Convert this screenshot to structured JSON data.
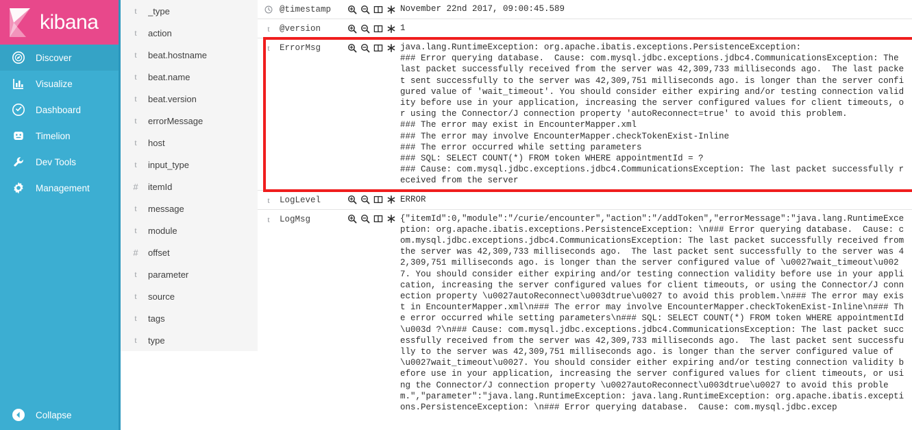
{
  "brand": {
    "name": "kibana",
    "logo_icon": "kibana-logo-icon",
    "bar_color": "#e8488b",
    "nav_color": "#3caed2",
    "nav_active_color": "#35a3c6"
  },
  "globalnav": {
    "items": [
      {
        "label": "Discover",
        "icon": "discover-compass-icon",
        "active": true
      },
      {
        "label": "Visualize",
        "icon": "visualize-bars-icon",
        "active": false
      },
      {
        "label": "Dashboard",
        "icon": "dashboard-gauge-icon",
        "active": false
      },
      {
        "label": "Timelion",
        "icon": "timelion-icon",
        "active": false
      },
      {
        "label": "Dev Tools",
        "icon": "wrench-icon",
        "active": false
      },
      {
        "label": "Management",
        "icon": "gear-icon",
        "active": false
      }
    ],
    "collapse": {
      "label": "Collapse",
      "icon": "collapse-left-arrow-icon"
    }
  },
  "fieldbar": {
    "fields": [
      {
        "name": "_type",
        "type": "t"
      },
      {
        "name": "action",
        "type": "t"
      },
      {
        "name": "beat.hostname",
        "type": "t"
      },
      {
        "name": "beat.name",
        "type": "t"
      },
      {
        "name": "beat.version",
        "type": "t"
      },
      {
        "name": "errorMessage",
        "type": "t"
      },
      {
        "name": "host",
        "type": "t"
      },
      {
        "name": "input_type",
        "type": "t"
      },
      {
        "name": "itemId",
        "type": "#"
      },
      {
        "name": "message",
        "type": "t"
      },
      {
        "name": "module",
        "type": "t"
      },
      {
        "name": "offset",
        "type": "#"
      },
      {
        "name": "parameter",
        "type": "t"
      },
      {
        "name": "source",
        "type": "t"
      },
      {
        "name": "tags",
        "type": "t"
      },
      {
        "name": "type",
        "type": "t"
      }
    ]
  },
  "doc_actions": {
    "filter_for_value": "magnifier-plus-icon",
    "filter_out_value": "magnifier-minus-icon",
    "toggle_column": "toggle-column-icon",
    "filter_for_field_present": "asterisk-icon"
  },
  "document": {
    "rows": [
      {
        "field": "@timestamp",
        "type": "clock",
        "value": "November 22nd 2017, 09:00:45.589",
        "highlighted": false
      },
      {
        "field": "@version",
        "type": "t",
        "value": "1",
        "highlighted": false
      },
      {
        "field": "ErrorMsg",
        "type": "t",
        "highlighted": true,
        "value": "java.lang.RuntimeException: org.apache.ibatis.exceptions.PersistenceException:\n### Error querying database.  Cause: com.mysql.jdbc.exceptions.jdbc4.CommunicationsException: The last packet successfully received from the server was 42,309,733 milliseconds ago.  The last packet sent successfully to the server was 42,309,751 milliseconds ago. is longer than the server configured value of 'wait_timeout'. You should consider either expiring and/or testing connection validity before use in your application, increasing the server configured values for client timeouts, or using the Connector/J connection property 'autoReconnect=true' to avoid this problem.\n### The error may exist in EncounterMapper.xml\n### The error may involve EncounterMapper.checkTokenExist-Inline\n### The error occurred while setting parameters\n### SQL: SELECT COUNT(*) FROM token WHERE appointmentId = ?\n### Cause: com.mysql.jdbc.exceptions.jdbc4.CommunicationsException: The last packet successfully received from the server"
      },
      {
        "field": "LogLevel",
        "type": "t",
        "value": "ERROR",
        "highlighted": false
      },
      {
        "field": "LogMsg",
        "type": "t",
        "highlighted": false,
        "value": "{\"itemId\":0,\"module\":\"/curie/encounter\",\"action\":\"/addToken\",\"errorMessage\":\"java.lang.RuntimeException: org.apache.ibatis.exceptions.PersistenceException: \\n### Error querying database.  Cause: com.mysql.jdbc.exceptions.jdbc4.CommunicationsException: The last packet successfully received from the server was 42,309,733 milliseconds ago.  The last packet sent successfully to the server was 42,309,751 milliseconds ago. is longer than the server configured value of \\u0027wait_timeout\\u0027. You should consider either expiring and/or testing connection validity before use in your application, increasing the server configured values for client timeouts, or using the Connector/J connection property \\u0027autoReconnect\\u003dtrue\\u0027 to avoid this problem.\\n### The error may exist in EncounterMapper.xml\\n### The error may involve EncounterMapper.checkTokenExist-Inline\\n### The error occurred while setting parameters\\n### SQL: SELECT COUNT(*) FROM token WHERE appointmentId \\u003d ?\\n### Cause: com.mysql.jdbc.exceptions.jdbc4.CommunicationsException: The last packet successfully received from the server was 42,309,733 milliseconds ago.  The last packet sent successfully to the server was 42,309,751 milliseconds ago. is longer than the server configured value of \\u0027wait_timeout\\u0027. You should consider either expiring and/or testing connection validity before use in your application, increasing the server configured values for client timeouts, or using the Connector/J connection property \\u0027autoReconnect\\u003dtrue\\u0027 to avoid this problem.\",\"parameter\":\"java.lang.RuntimeException: java.lang.RuntimeException: org.apache.ibatis.exceptions.PersistenceException: \\n### Error querying database.  Cause: com.mysql.jdbc.excep"
      }
    ],
    "highlight_color": "#f01e1e"
  }
}
